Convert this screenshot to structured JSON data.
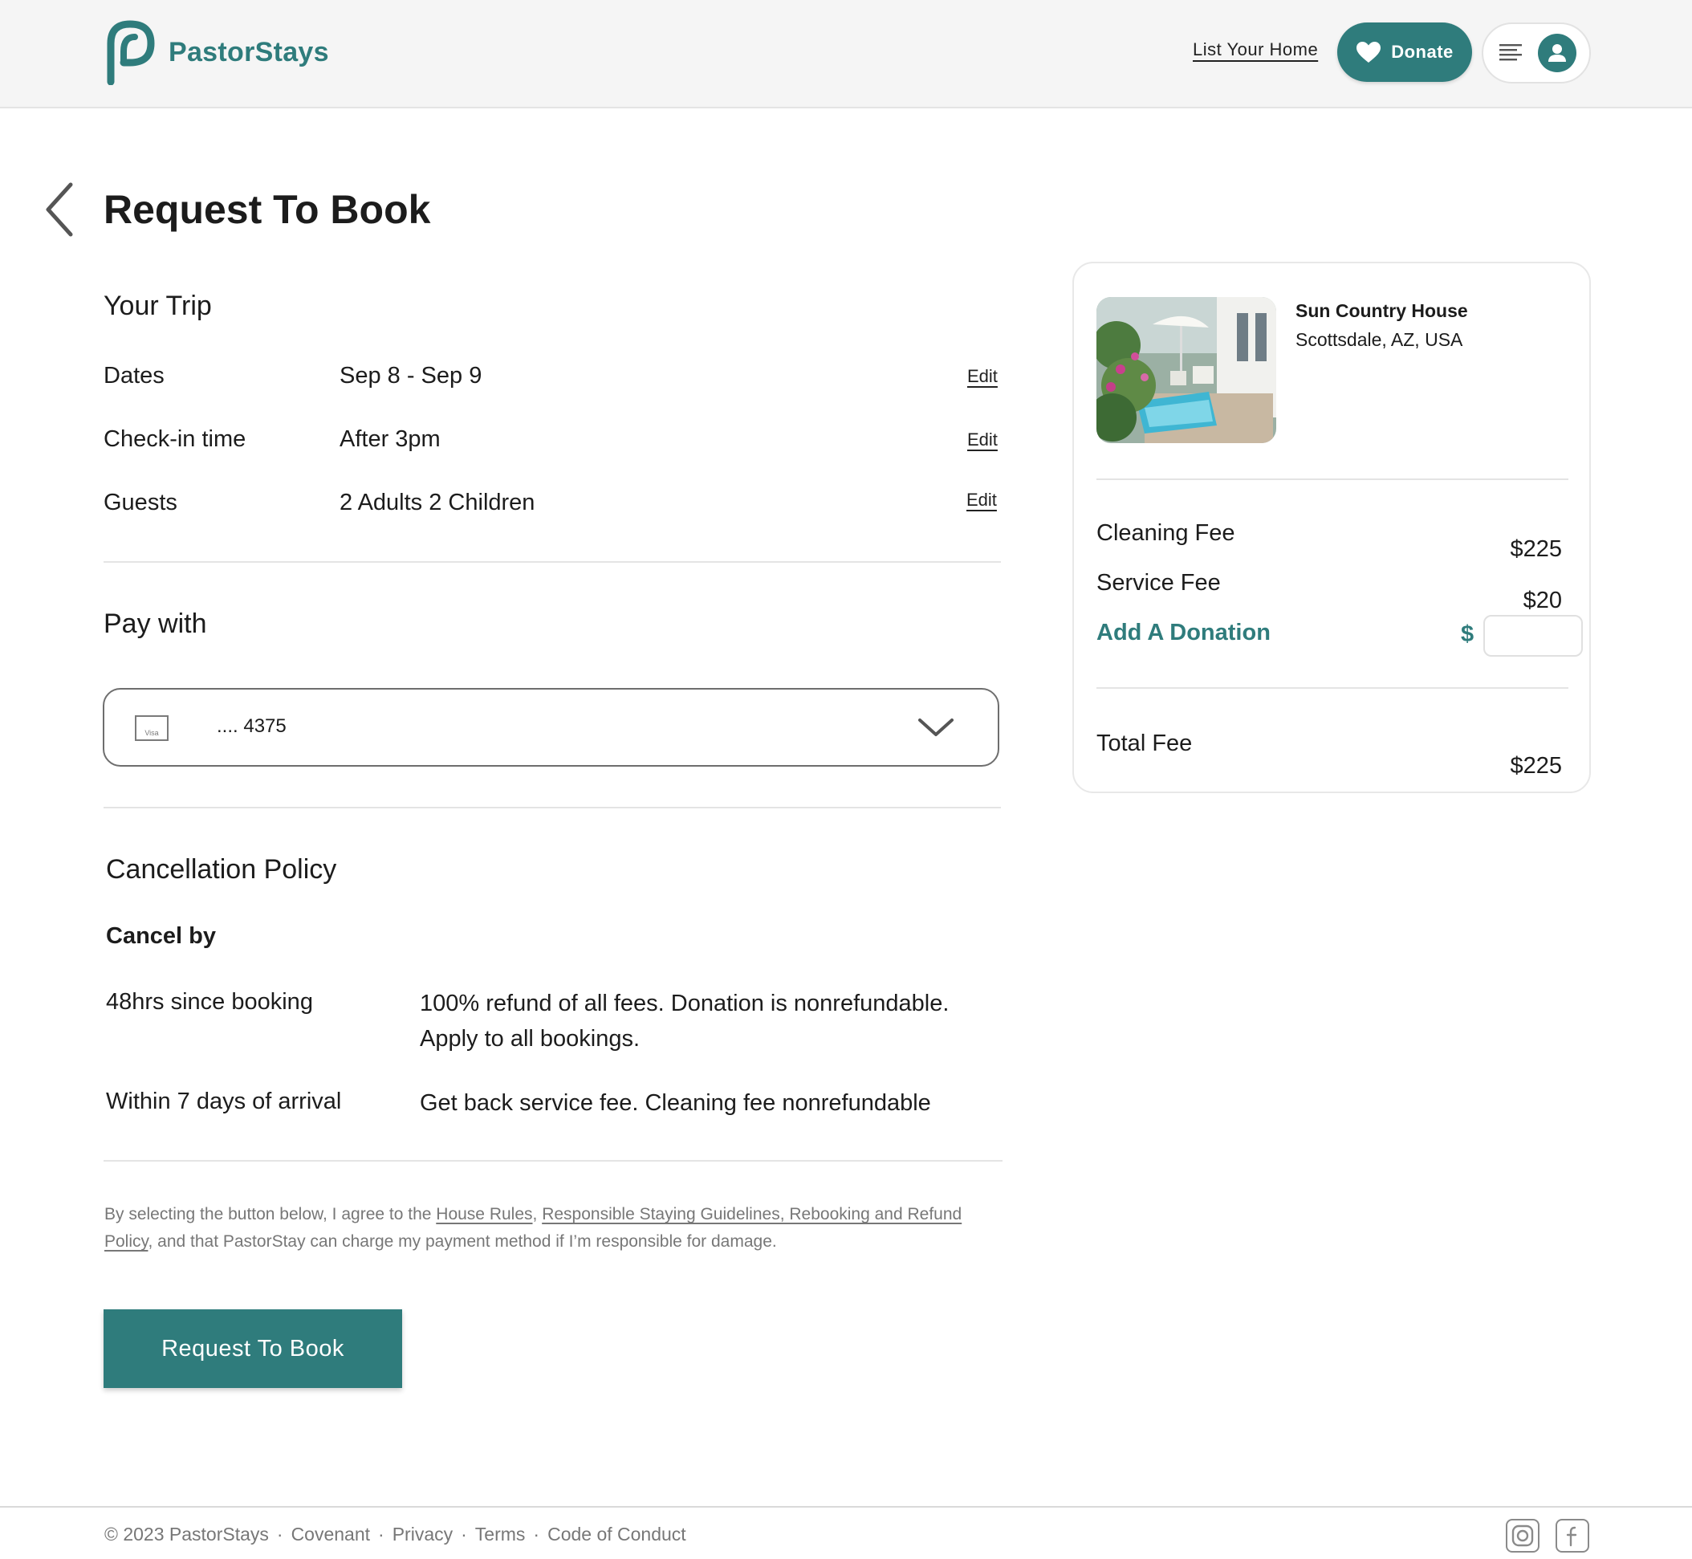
{
  "header": {
    "brand": "PastorStays",
    "list_home": "List Your Home",
    "donate": "Donate"
  },
  "page": {
    "title": "Request To Book"
  },
  "trip": {
    "title": "Your Trip",
    "rows": [
      {
        "label": "Dates",
        "value": "Sep 8 - Sep 9",
        "action": "Edit"
      },
      {
        "label": "Check-in time",
        "value": "After 3pm",
        "action": "Edit"
      },
      {
        "label": "Guests",
        "value": "2 Adults 2 Children",
        "action": "Edit"
      }
    ]
  },
  "payment": {
    "title": "Pay with",
    "card_brand": "Visa",
    "card_number": ".... 4375"
  },
  "cancellation": {
    "title": "Cancellation Policy",
    "cancel_by": "Cancel by",
    "rows": [
      {
        "when": "48hrs since booking",
        "desc": "100% refund of all fees. Donation is nonrefundable. Apply to all bookings."
      },
      {
        "when": "Within 7 days of arrival",
        "desc": "Get back service fee. Cleaning fee nonrefundable"
      }
    ]
  },
  "agreement": {
    "prefix": "By selecting the button below, I agree to the ",
    "house_rules": "House Rules",
    "comma": ", ",
    "guidelines": "Responsible Staying Guidelines, Rebooking and Refund Policy",
    "suffix": ", and that PastorStay can charge my payment method if I’m responsible for damage."
  },
  "cta": {
    "book": "Request To Book"
  },
  "summary": {
    "house_name": "Sun Country House",
    "location": "Scottsdale, AZ, USA",
    "cleaning_fee_label": "Cleaning Fee",
    "cleaning_fee": "$225",
    "service_fee_label": "Service Fee",
    "service_fee": "$20",
    "donation_label": "Add A Donation",
    "donation_currency": "$",
    "donation_value": "",
    "total_label": "Total Fee",
    "total": "$225"
  },
  "footer": {
    "copyright": "© 2023 PastorStays",
    "links": [
      "Covenant",
      "Privacy",
      "Terms",
      "Code of Conduct"
    ],
    "separator": "·"
  },
  "icons": {
    "logo": "pastorstays-logo-icon",
    "back": "chevron-left-icon",
    "heart": "heart-icon",
    "menu": "menu-lines-icon",
    "user": "user-icon",
    "card": "visa-card-icon",
    "dropdown": "chevron-down-icon",
    "instagram": "instagram-icon",
    "facebook": "facebook-icon"
  },
  "colors": {
    "brand": "#2f7c7c",
    "text": "#1c1c1c",
    "muted": "#777777",
    "header_bg": "#f5f5f5",
    "divider": "#e4e4e4"
  }
}
